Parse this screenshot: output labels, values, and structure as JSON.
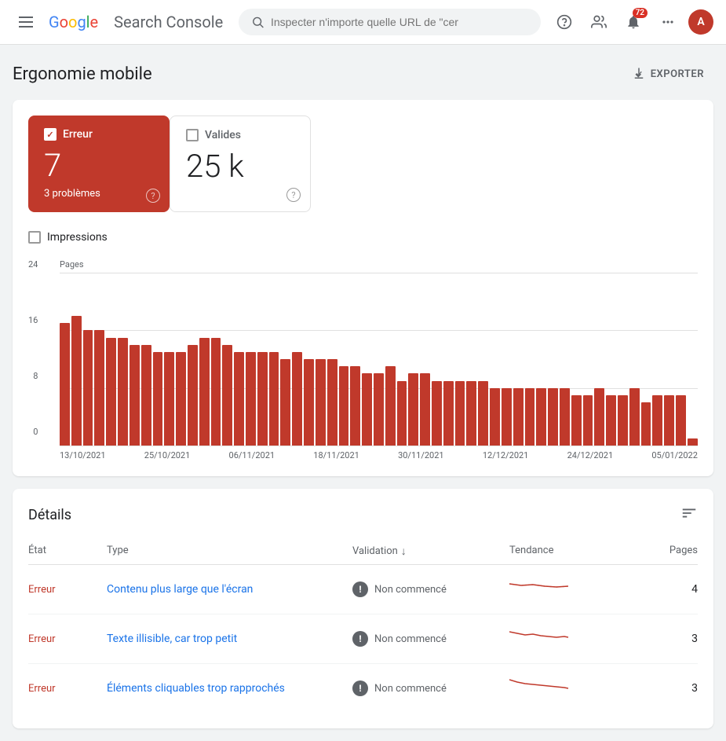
{
  "header": {
    "menu_label": "menu",
    "logo_letters": [
      "G",
      "o",
      "o",
      "g",
      "l",
      "e"
    ],
    "app_name": "Search Console",
    "search_placeholder": "Inspecter n'importe quelle URL de \"cer",
    "notification_count": "72",
    "avatar_letter": "A"
  },
  "page": {
    "title": "Ergonomie mobile",
    "export_label": "EXPORTER"
  },
  "stats": {
    "error": {
      "label": "Erreur",
      "value": "7",
      "sublabel": "3 problèmes",
      "checked": true,
      "help": "?"
    },
    "valid": {
      "label": "Valides",
      "value": "25 k",
      "checked": false,
      "help": "?"
    }
  },
  "impressions": {
    "label": "Impressions"
  },
  "chart": {
    "y_labels": [
      "24",
      "16",
      "8",
      "0"
    ],
    "x_labels": [
      "13/10/2021",
      "25/10/2021",
      "06/11/2021",
      "18/11/2021",
      "30/11/2021",
      "12/12/2021",
      "24/12/2021",
      "05/01/2022"
    ],
    "bars": [
      17,
      18,
      16,
      16,
      15,
      15,
      14,
      14,
      13,
      13,
      13,
      14,
      15,
      15,
      14,
      13,
      13,
      13,
      13,
      12,
      13,
      12,
      12,
      12,
      11,
      11,
      10,
      10,
      11,
      9,
      10,
      10,
      9,
      9,
      9,
      9,
      9,
      8,
      8,
      8,
      8,
      8,
      8,
      8,
      7,
      7,
      8,
      7,
      7,
      8,
      6,
      7,
      7,
      7,
      1
    ],
    "max_value": 24
  },
  "details": {
    "title": "Détails",
    "columns": {
      "state": "État",
      "type": "Type",
      "validation": "Validation",
      "trend": "Tendance",
      "pages": "Pages"
    },
    "rows": [
      {
        "state": "Erreur",
        "type": "Contenu plus large que l'écran",
        "validation": "Non commencé",
        "pages": "4"
      },
      {
        "state": "Erreur",
        "type": "Texte illisible, car trop petit",
        "validation": "Non commencé",
        "pages": "3"
      },
      {
        "state": "Erreur",
        "type": "Éléments cliquables trop rapprochés",
        "validation": "Non commencé",
        "pages": "3"
      }
    ]
  }
}
